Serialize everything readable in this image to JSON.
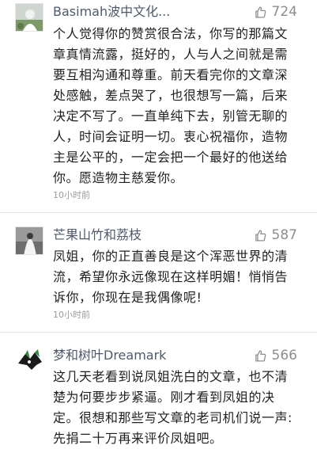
{
  "comments": [
    {
      "username": "Basimah波中文化...",
      "likes": "724",
      "text": "个人觉得你的赞赏很合法，你写的那篇文章真情流露，挺好的，人与人之间就是需要互相沟通和尊重。前天看完你的文章深处感触，差点哭了，也很想写一篇，后来决定不写了。一直单纯下去，别管无聊的人，时间会证明一切。衷心祝福你，造物主是公平的，一定会把一个最好的他送给你。愿造物主慈爱你。",
      "time": "10小时前"
    },
    {
      "username": "芒果山竹和荔枝",
      "likes": "587",
      "text": "凤姐，你的正直善良是这个浑恶世界的清流，希望你永远像现在这样明媚！悄悄告诉你，你现在是我偶像呢!",
      "time": "10小时前"
    },
    {
      "username": "梦和树叶Dreamark",
      "likes": "566",
      "text": "这几天老看到说凤姐洗白的文章，也不清楚为何要步步紧逼。刚才看到凤姐的决定。很想和那些写文章的老司机们说一声:先捐二十万再来评价凤姐吧。",
      "time": ""
    }
  ],
  "icons": {
    "like": "thumbs-up-icon"
  },
  "colors": {
    "username": "#4e5a6a",
    "likes": "#8e8e8e",
    "text": "#1f1f1f",
    "time": "#9a9a9a"
  }
}
